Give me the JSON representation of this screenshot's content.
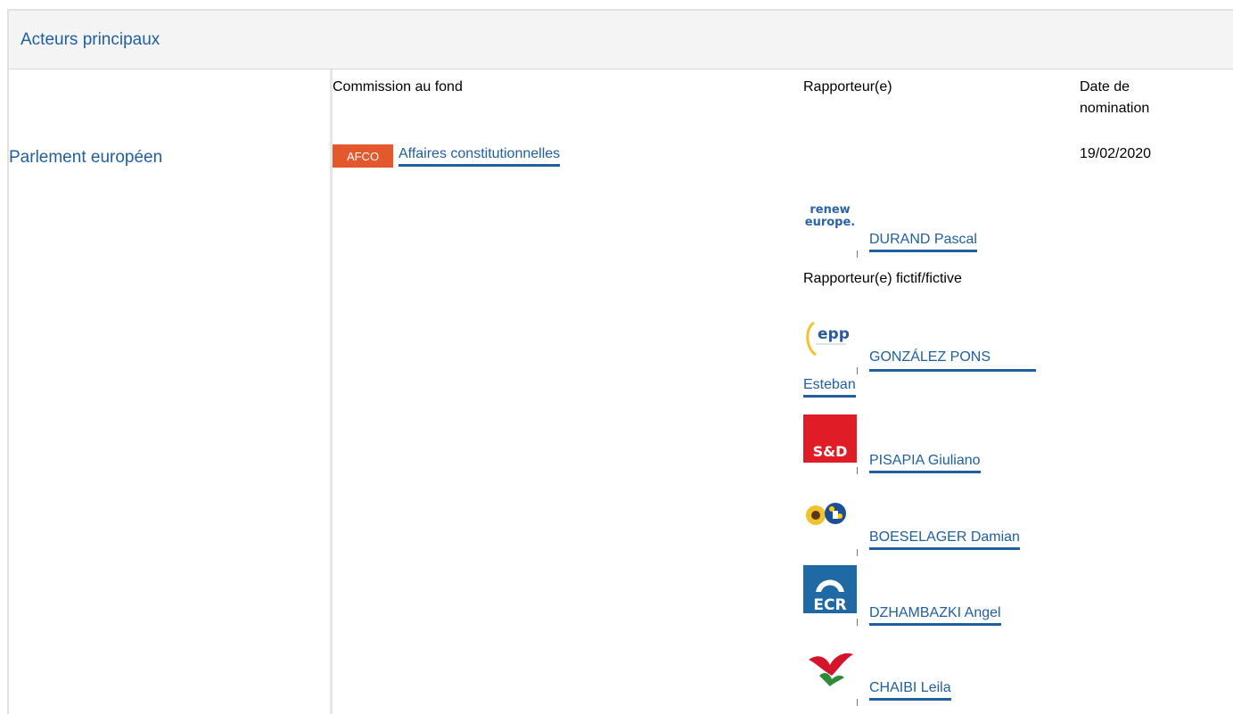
{
  "header": {
    "title": "Acteurs principaux"
  },
  "institution": {
    "name": "Parlement européen"
  },
  "table": {
    "col_committee": "Commission au fond",
    "col_rapporteur": "Rapporteur(e)",
    "col_date": "Date de nomination",
    "committee": {
      "badge": "AFCO",
      "name": "Affaires constitutionnelles",
      "date": "19/02/2020"
    },
    "shadow_label": "Rapporteur(e) fictif/fictive",
    "rapporteur": {
      "name": "DURAND Pascal",
      "group_logo": "renew-europe-logo",
      "logo_text_1": "renew",
      "logo_text_2": "europe."
    },
    "shadows": [
      {
        "name_line1": "GONZÁLEZ PONS",
        "name_line2": "Esteban",
        "group_logo": "epp-logo",
        "logo_text": "epp"
      },
      {
        "name": "PISAPIA Giuliano",
        "group_logo": "sd-logo",
        "logo_text": "S&D"
      },
      {
        "name": "BOESELAGER Damian",
        "group_logo": "greens-efa-logo"
      },
      {
        "name": "DZHAMBAZKI Angel",
        "group_logo": "ecr-logo",
        "logo_text": "ECR"
      },
      {
        "name": "CHAIBI Leila",
        "group_logo": "left-logo"
      }
    ]
  },
  "colors": {
    "link": "#1f5fa0",
    "badge": "#e3582d",
    "header_bg": "#f4f4f4"
  }
}
